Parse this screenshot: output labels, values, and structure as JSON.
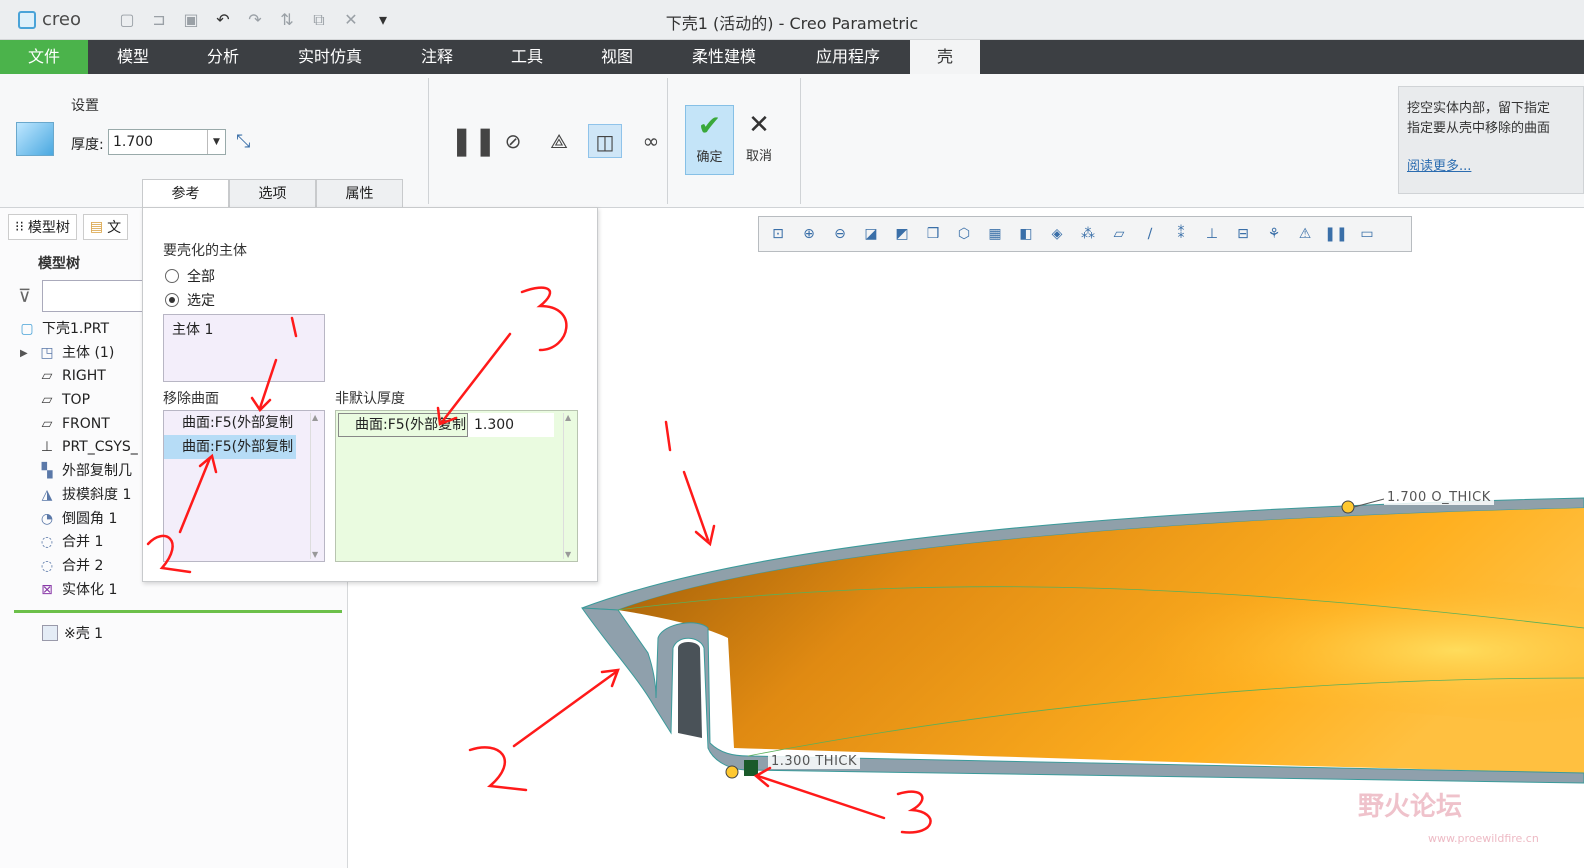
{
  "window": {
    "app_logo": "creo",
    "title": "下壳1 (活动的) - Creo Parametric"
  },
  "quick_access": [
    "new-icon",
    "open-icon",
    "save-icon",
    "undo-icon",
    "redo-icon",
    "regenerate-icon",
    "window-icon",
    "close-icon",
    "customize-icon"
  ],
  "menu": {
    "tabs": [
      "文件",
      "模型",
      "分析",
      "实时仿真",
      "注释",
      "工具",
      "视图",
      "柔性建模",
      "应用程序",
      "壳"
    ],
    "active": "壳"
  },
  "ribbon": {
    "settings_label": "设置",
    "thickness_label": "厚度:",
    "thickness_value": "1.700",
    "subtabs": [
      "参考",
      "选项",
      "属性"
    ],
    "ok_label": "确定",
    "cancel_label": "取消",
    "tip_line1": "挖空实体内部，留下指定",
    "tip_line2": "指定要从壳中移除的曲面",
    "tip_more": "阅读更多..."
  },
  "model_tree": {
    "tab1": "模型树",
    "tab2": "文",
    "header": "模型树",
    "items": [
      {
        "label": "下壳1.PRT",
        "icon": "part-icon"
      },
      {
        "label": "主体 (1)",
        "icon": "body-icon",
        "expandable": true
      },
      {
        "label": "RIGHT",
        "icon": "datum-plane-icon"
      },
      {
        "label": "TOP",
        "icon": "datum-plane-icon"
      },
      {
        "label": "FRONT",
        "icon": "datum-plane-icon"
      },
      {
        "label": "PRT_CSYS_",
        "icon": "csys-icon"
      },
      {
        "label": "外部复制几",
        "icon": "external-copy-icon"
      },
      {
        "label": "拔模斜度 1",
        "icon": "draft-icon"
      },
      {
        "label": "倒圆角 1",
        "icon": "round-icon"
      },
      {
        "label": "合并 1",
        "icon": "merge-icon"
      },
      {
        "label": "合并 2",
        "icon": "merge-icon"
      },
      {
        "label": "实体化 1",
        "icon": "solidify-icon"
      }
    ],
    "insert_feature": "※壳 1"
  },
  "references": {
    "body_section": "要壳化的主体",
    "radio_all": "全部",
    "radio_selected": "选定",
    "selected_option": "选定",
    "body_item": "主体 1",
    "remove_section": "移除曲面",
    "remove_items": [
      "曲面:F5(外部复制",
      "曲面:F5(外部复制"
    ],
    "nondefault_section": "非默认厚度",
    "nondefault_surface": "曲面:F5(外部复制",
    "nondefault_value": "1.300"
  },
  "viewport": {
    "dim_top": "1.700 O_THICK",
    "dim_bottom": "1.300 THICK",
    "watermark": "野火论坛",
    "watermark_url": "www.proewildfire.cn"
  },
  "annotations": [
    "1",
    "2",
    "3",
    "1",
    "2",
    "3"
  ],
  "colors": {
    "accent_green": "#4bb34b",
    "menubar": "#3c3f43",
    "shell_orange": "#f0a020",
    "annotation_red": "#ff1a1a"
  }
}
